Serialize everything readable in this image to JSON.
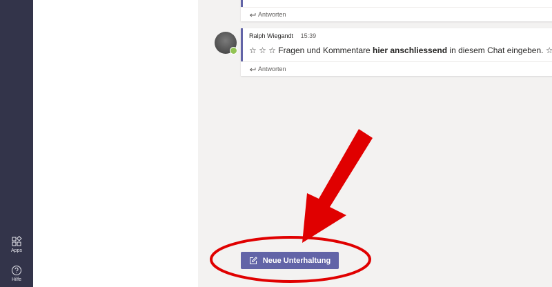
{
  "app_rail": {
    "items": [
      {
        "label": "Apps",
        "icon": "apps-icon"
      },
      {
        "label": "Hilfe",
        "icon": "help-icon"
      }
    ]
  },
  "conversation": {
    "messages": [
      {
        "reply_label": "Antworten"
      },
      {
        "author": "Ralph Wiegandt",
        "time": "15:39",
        "text_before": "☆ ☆ ☆ Fragen und Kommentare ",
        "text_bold": "hier anschliessend",
        "text_after": " in diesem Chat eingeben. ☆ ☆ ☆",
        "reply_label": "Antworten"
      }
    ]
  },
  "new_conversation_button": {
    "label": "Neue Unterhaltung"
  },
  "annotation": {
    "color": "#e00000"
  },
  "colors": {
    "rail": "#33344a",
    "accent": "#6264a7",
    "canvas": "#f3f2f1",
    "presence": "#92c353"
  }
}
